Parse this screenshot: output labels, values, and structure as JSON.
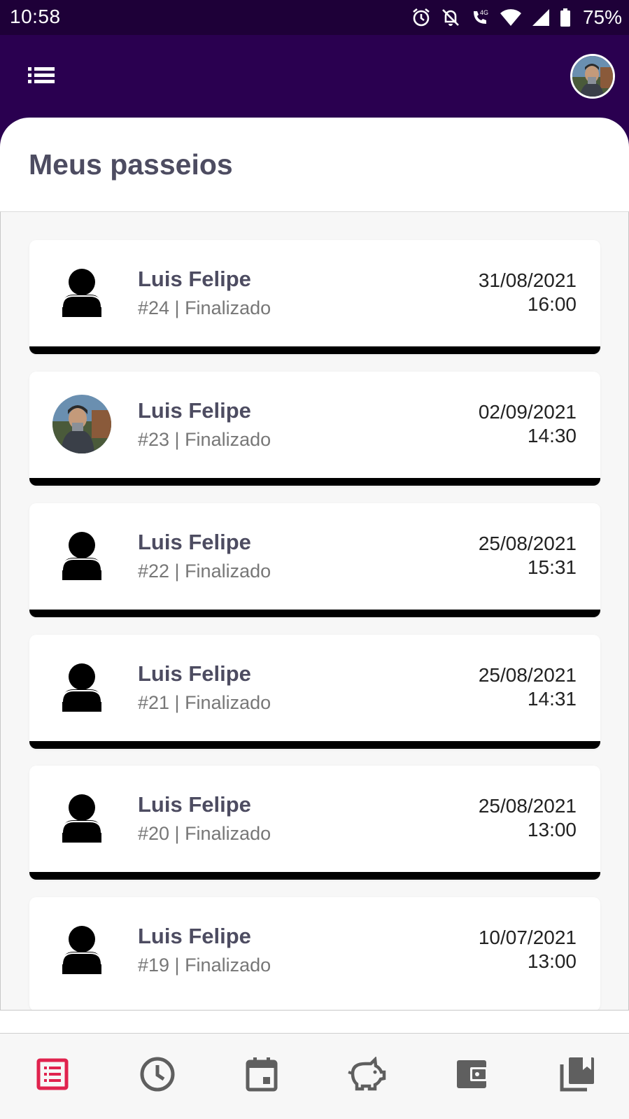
{
  "status_bar": {
    "time": "10:58",
    "battery_percent": "75%",
    "icons": [
      "alarm-icon",
      "notifications-off-icon",
      "volte-4g-call-icon",
      "wifi-icon",
      "cell-signal-icon",
      "battery-icon"
    ]
  },
  "app_bar": {
    "menu_icon": "list-menu-icon",
    "avatar": "user-profile-photo"
  },
  "page": {
    "title": "Meus passeios"
  },
  "walks": [
    {
      "name": "Luis Felipe",
      "subtitle": "#24 | Finalizado",
      "date": "31/08/2021",
      "time": "16:00",
      "avatar": "person-icon"
    },
    {
      "name": "Luis Felipe",
      "subtitle": "#23 | Finalizado",
      "date": "02/09/2021",
      "time": "14:30",
      "avatar": "photo"
    },
    {
      "name": "Luis Felipe",
      "subtitle": "#22 | Finalizado",
      "date": "25/08/2021",
      "time": "15:31",
      "avatar": "person-icon"
    },
    {
      "name": "Luis Felipe",
      "subtitle": "#21 | Finalizado",
      "date": "25/08/2021",
      "time": "14:31",
      "avatar": "person-icon"
    },
    {
      "name": "Luis Felipe",
      "subtitle": "#20 | Finalizado",
      "date": "25/08/2021",
      "time": "13:00",
      "avatar": "person-icon"
    },
    {
      "name": "Luis Felipe",
      "subtitle": "#19 | Finalizado",
      "date": "10/07/2021",
      "time": "13:00",
      "avatar": "person-icon"
    }
  ],
  "bottom_nav": {
    "active": "walks-list",
    "active_color": "#e0234e",
    "inactive_color": "#5f5f5f",
    "items": [
      "walks-list-icon",
      "history-clock-icon",
      "calendar-icon",
      "savings-piggy-icon",
      "wallet-icon",
      "library-bookmark-icon"
    ]
  },
  "colors": {
    "app_bar": "#2a0050",
    "status_bar": "#1e0038",
    "title_text": "#4d4c61"
  }
}
